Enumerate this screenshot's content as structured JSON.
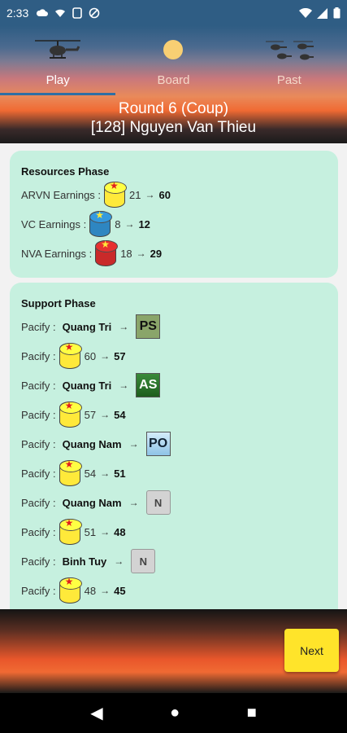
{
  "status_bar": {
    "time": "2:33"
  },
  "tabs": [
    {
      "label": "Play",
      "icon": "helicopter-icon"
    },
    {
      "label": "Board",
      "icon": "sun-icon"
    },
    {
      "label": "Past",
      "icon": "helicopter-group-icon"
    }
  ],
  "round": {
    "line1": "Round 6 (Coup)",
    "line2": "[128] Nguyen Van Thieu"
  },
  "resources": {
    "title": "Resources Phase",
    "rows": [
      {
        "label": "ARVN Earnings :",
        "from": "21",
        "to": "60"
      },
      {
        "label": "VC Earnings :",
        "from": "8",
        "to": "12"
      },
      {
        "label": "NVA Earnings :",
        "from": "18",
        "to": "29"
      }
    ]
  },
  "support": {
    "title": "Support Phase",
    "rows": [
      {
        "label": "Pacify :",
        "place": "Quang Tri",
        "marker": "PS"
      },
      {
        "label": "Pacify :",
        "from": "60",
        "to": "57"
      },
      {
        "label": "Pacify :",
        "place": "Quang Tri",
        "marker": "AS"
      },
      {
        "label": "Pacify :",
        "from": "57",
        "to": "54"
      },
      {
        "label": "Pacify :",
        "place": "Quang Nam",
        "marker": "PO"
      },
      {
        "label": "Pacify :",
        "from": "54",
        "to": "51"
      },
      {
        "label": "Pacify :",
        "place": "Quang Nam",
        "marker": "N"
      },
      {
        "label": "Pacify :",
        "from": "51",
        "to": "48"
      },
      {
        "label": "Pacify :",
        "place": "Binh Tuy",
        "marker": "N"
      },
      {
        "label": "Pacify :",
        "from": "48",
        "to": "45"
      }
    ]
  },
  "arrow": "→",
  "next_label": "Next",
  "colors": {
    "card": "#c6f0df",
    "next": "#ffe42a",
    "accent": "#2f6fa4"
  }
}
